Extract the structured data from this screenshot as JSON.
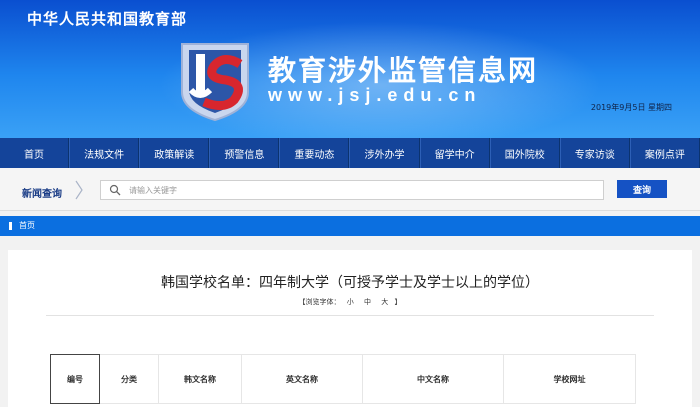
{
  "header": {
    "ministry": "中华人民共和国教育部",
    "site_name": "教育涉外监管信息网",
    "site_url": "www.jsj.edu.cn",
    "date": "2019年9月5日 星期四"
  },
  "nav": [
    {
      "label": "首页"
    },
    {
      "label": "法规文件"
    },
    {
      "label": "政策解读"
    },
    {
      "label": "预警信息"
    },
    {
      "label": "重要动态"
    },
    {
      "label": "涉外办学"
    },
    {
      "label": "留学中介"
    },
    {
      "label": "国外院校"
    },
    {
      "label": "专家访谈"
    },
    {
      "label": "案例点评"
    }
  ],
  "search": {
    "label": "新闻查询",
    "placeholder": "请输入关键字",
    "button": "查询",
    "icon": "search-icon"
  },
  "breadcrumb": {
    "home": "首页"
  },
  "article": {
    "title": "韩国学校名单：四年制大学（可授予学士及学士以上的学位）",
    "font_size": {
      "prefix": "【浏览字体：",
      "small": "小",
      "medium": "中",
      "large": "大",
      "suffix": "】"
    },
    "table_headers": [
      "编号",
      "分类",
      "韩文名称",
      "英文名称",
      "中文名称",
      "学校网址"
    ]
  },
  "colors": {
    "banner": "#1f86ee",
    "nav": "#14449a",
    "accent": "#1552c4",
    "breadcrumb": "#0b6fe0",
    "logo_red": "#d8262e"
  }
}
